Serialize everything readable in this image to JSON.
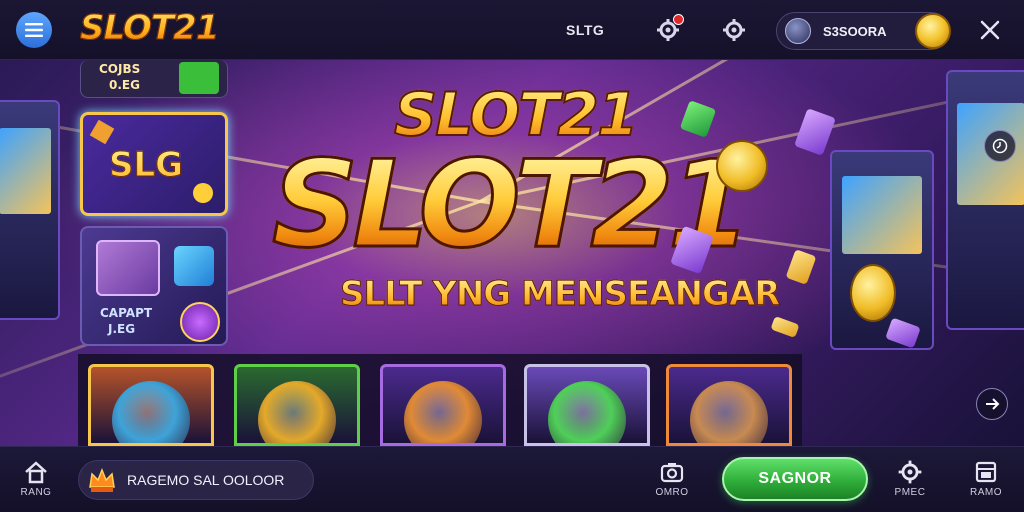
{
  "header": {
    "logo": "SLOT21",
    "nav_link": "SLTG",
    "account_name": "S3SOORA"
  },
  "side_cards": {
    "top_label_line1": "COJBS",
    "top_label_line2": "0.EG",
    "featured_label": "SLG",
    "dice_label_line1": "CAPAPT",
    "dice_label_line2": "J.EG"
  },
  "hero": {
    "title_small": "SLOT21",
    "title_big": "SLOT21",
    "subtitle": "SLLT YNG MENSEANGAR"
  },
  "games": [
    {
      "name": "robot-cat",
      "border": "#f6c74b",
      "bg": "#b5532a",
      "char": "#3ea3d8"
    },
    {
      "name": "golden-ring",
      "border": "#5fcf4a",
      "bg": "#2a6a30",
      "char": "#e3a92a"
    },
    {
      "name": "lion",
      "border": "#a66be0",
      "bg": "#4b2a8e",
      "char": "#e08a36"
    },
    {
      "name": "green-hair-girl",
      "border": "#c9c2e8",
      "bg": "#6a4ab8",
      "char": "#4fcf58"
    },
    {
      "name": "bear-coin",
      "border": "#ef8a3a",
      "bg": "#4b2a8e",
      "char": "#c78a52"
    }
  ],
  "bottom_nav": {
    "home_label": "RANG",
    "promo_text": "RAGEMO SAL OOLOOR",
    "camera_label": "OMRO",
    "cta_label": "SAGNOR",
    "settings_label": "PMEC",
    "more_label": "RAMO"
  },
  "colors": {
    "accent_gold": "#ffbf2c",
    "cta_green": "#2fae3a",
    "notification_red": "#e0272b"
  }
}
